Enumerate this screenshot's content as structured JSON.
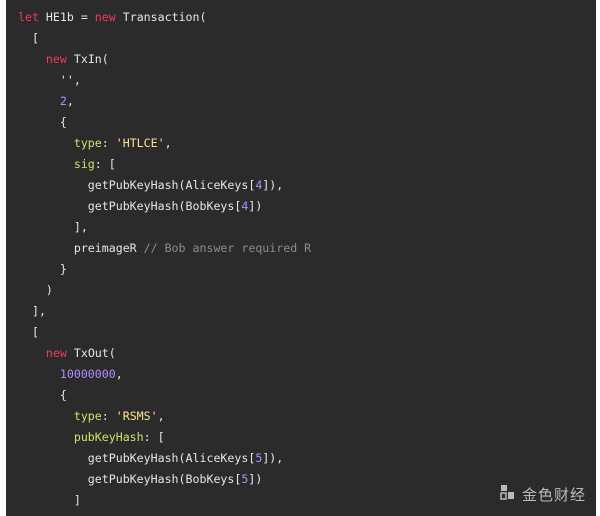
{
  "code": {
    "lines": [
      {
        "tokens": [
          {
            "t": "let",
            "c": "kw"
          },
          {
            "t": " HE1b = ",
            "c": "plain"
          },
          {
            "t": "new",
            "c": "kw"
          },
          {
            "t": " Transaction(",
            "c": "plain"
          }
        ]
      },
      {
        "tokens": [
          {
            "t": "  [",
            "c": "plain"
          }
        ]
      },
      {
        "tokens": [
          {
            "t": "    ",
            "c": "plain"
          },
          {
            "t": "new",
            "c": "kw"
          },
          {
            "t": " TxIn(",
            "c": "plain"
          }
        ]
      },
      {
        "tokens": [
          {
            "t": "      ",
            "c": "plain"
          },
          {
            "t": "''",
            "c": "str"
          },
          {
            "t": ",",
            "c": "plain"
          }
        ]
      },
      {
        "tokens": [
          {
            "t": "      ",
            "c": "plain"
          },
          {
            "t": "2",
            "c": "num"
          },
          {
            "t": ",",
            "c": "plain"
          }
        ]
      },
      {
        "tokens": [
          {
            "t": "      {",
            "c": "plain"
          }
        ]
      },
      {
        "tokens": [
          {
            "t": "        ",
            "c": "plain"
          },
          {
            "t": "type",
            "c": "prop"
          },
          {
            "t": ": ",
            "c": "plain"
          },
          {
            "t": "'HTLCE'",
            "c": "str"
          },
          {
            "t": ",",
            "c": "plain"
          }
        ]
      },
      {
        "tokens": [
          {
            "t": "        ",
            "c": "plain"
          },
          {
            "t": "sig",
            "c": "prop"
          },
          {
            "t": ": [",
            "c": "plain"
          }
        ]
      },
      {
        "tokens": [
          {
            "t": "          getPubKeyHash(AliceKeys[",
            "c": "plain"
          },
          {
            "t": "4",
            "c": "num"
          },
          {
            "t": "]),",
            "c": "plain"
          }
        ]
      },
      {
        "tokens": [
          {
            "t": "          getPubKeyHash(BobKeys[",
            "c": "plain"
          },
          {
            "t": "4",
            "c": "num"
          },
          {
            "t": "])",
            "c": "plain"
          }
        ]
      },
      {
        "tokens": [
          {
            "t": "        ],",
            "c": "plain"
          }
        ]
      },
      {
        "tokens": [
          {
            "t": "        preimageR ",
            "c": "plain"
          },
          {
            "t": "// Bob answer required R",
            "c": "comment"
          }
        ]
      },
      {
        "tokens": [
          {
            "t": "      }",
            "c": "plain"
          }
        ]
      },
      {
        "tokens": [
          {
            "t": "    )",
            "c": "plain"
          }
        ]
      },
      {
        "tokens": [
          {
            "t": "  ],",
            "c": "plain"
          }
        ]
      },
      {
        "tokens": [
          {
            "t": "  [",
            "c": "plain"
          }
        ]
      },
      {
        "tokens": [
          {
            "t": "    ",
            "c": "plain"
          },
          {
            "t": "new",
            "c": "kw"
          },
          {
            "t": " TxOut(",
            "c": "plain"
          }
        ]
      },
      {
        "tokens": [
          {
            "t": "      ",
            "c": "plain"
          },
          {
            "t": "10000000",
            "c": "num"
          },
          {
            "t": ",",
            "c": "plain"
          }
        ]
      },
      {
        "tokens": [
          {
            "t": "      {",
            "c": "plain"
          }
        ]
      },
      {
        "tokens": [
          {
            "t": "        ",
            "c": "plain"
          },
          {
            "t": "type",
            "c": "prop"
          },
          {
            "t": ": ",
            "c": "plain"
          },
          {
            "t": "'RSMS'",
            "c": "str"
          },
          {
            "t": ",",
            "c": "plain"
          }
        ]
      },
      {
        "tokens": [
          {
            "t": "        ",
            "c": "plain"
          },
          {
            "t": "pubKeyHash",
            "c": "prop"
          },
          {
            "t": ": [",
            "c": "plain"
          }
        ]
      },
      {
        "tokens": [
          {
            "t": "          getPubKeyHash(AliceKeys[",
            "c": "plain"
          },
          {
            "t": "5",
            "c": "num"
          },
          {
            "t": "]),",
            "c": "plain"
          }
        ]
      },
      {
        "tokens": [
          {
            "t": "          getPubKeyHash(BobKeys[",
            "c": "plain"
          },
          {
            "t": "5",
            "c": "num"
          },
          {
            "t": "])",
            "c": "plain"
          }
        ]
      },
      {
        "tokens": [
          {
            "t": "        ]",
            "c": "plain"
          }
        ]
      }
    ]
  },
  "watermark": {
    "text": "金色财经",
    "icon": "jinse-logo-icon",
    "color": "#c9c9c9"
  },
  "colors": {
    "background": "#2b2b2b",
    "keyword": "#f8365f",
    "property": "#cfe36a",
    "string": "#ffe38a",
    "number": "#b38cff",
    "comment": "#8b8b8b",
    "plain": "#e6e6e6"
  }
}
